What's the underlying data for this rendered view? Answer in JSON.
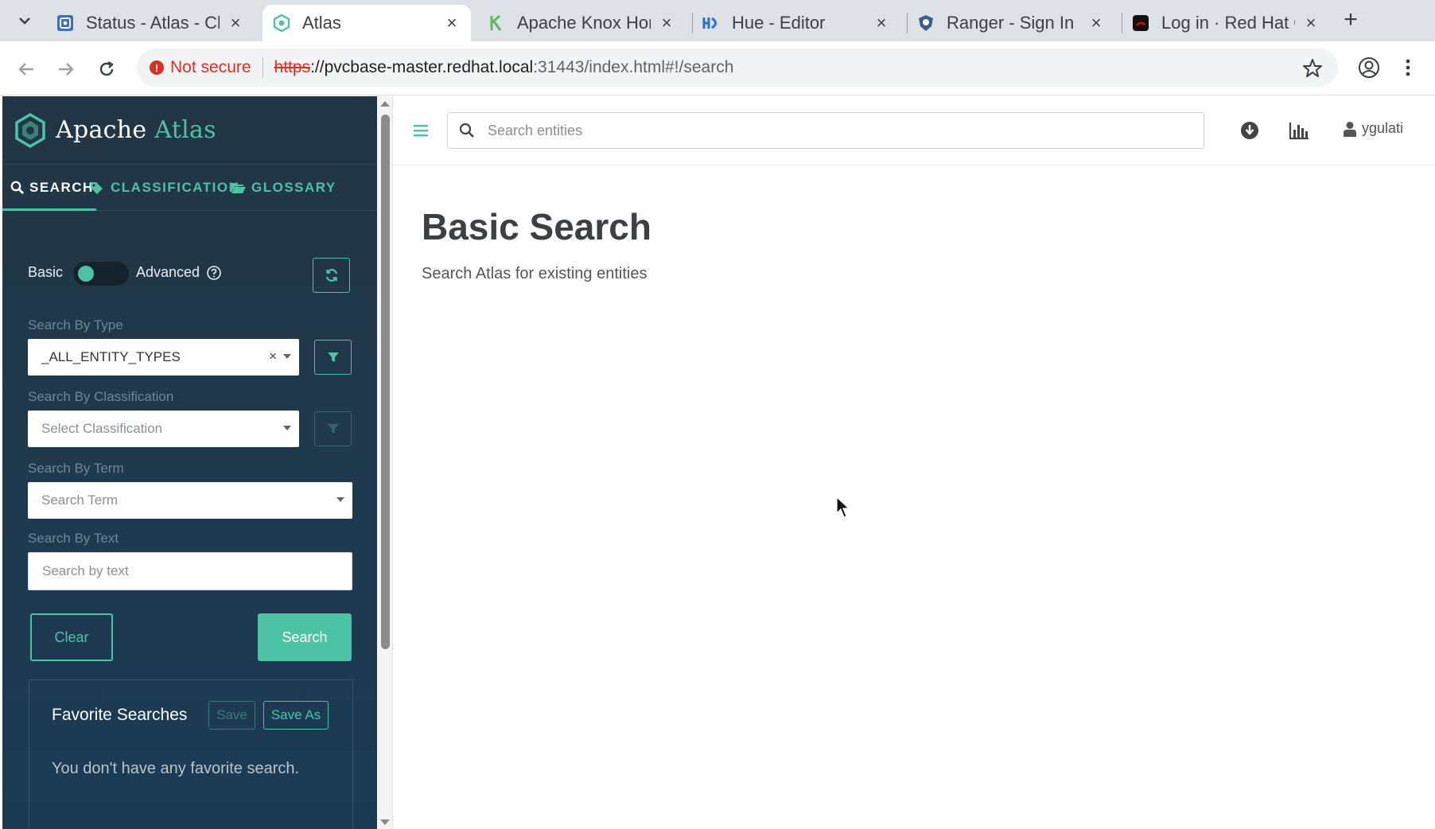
{
  "browser": {
    "tabs": [
      {
        "title": "Status - Atlas - Clo",
        "close": "×"
      },
      {
        "title": "Atlas",
        "close": "×"
      },
      {
        "title": "Apache Knox Hom",
        "close": "×"
      },
      {
        "title": "Hue - Editor",
        "close": "×"
      },
      {
        "title": "Ranger - Sign In",
        "close": "×"
      },
      {
        "title": "Log in · Red Hat O",
        "close": "×"
      }
    ],
    "new_tab": "+",
    "security_label": "Not secure",
    "url_scheme": "https",
    "url_host": "://pvcbase-master.redhat.local",
    "url_path": ":31443/index.html#!/search",
    "colors": {
      "insecure": "#d93025",
      "tabbar": "#dee1e6"
    }
  },
  "sidebar": {
    "logo_word1": "Apache",
    "logo_word2": "Atlas",
    "tabs": {
      "search": "SEARCH",
      "classification": "CLASSIFICATION",
      "glossary": "GLOSSARY"
    },
    "mode_basic": "Basic",
    "mode_advanced": "Advanced",
    "type_label": "Search By Type",
    "type_value": "_ALL_ENTITY_TYPES",
    "type_clear": "×",
    "classification_label": "Search By Classification",
    "classification_placeholder": "Select Classification",
    "term_label": "Search By Term",
    "term_placeholder": "Search Term",
    "text_label": "Search By Text",
    "text_placeholder": "Search by text",
    "clear_button": "Clear",
    "search_button": "Search",
    "favorites_title": "Favorite Searches",
    "favorites_save": "Save",
    "favorites_save_as": "Save As",
    "favorites_empty": "You don't have any favorite search.",
    "colors": {
      "accent": "#4dc3a5",
      "background": "#1f3a4e"
    }
  },
  "topbar": {
    "search_placeholder": "Search entities",
    "username": "ygulati"
  },
  "main": {
    "title": "Basic Search",
    "subtitle": "Search Atlas for existing entities"
  }
}
